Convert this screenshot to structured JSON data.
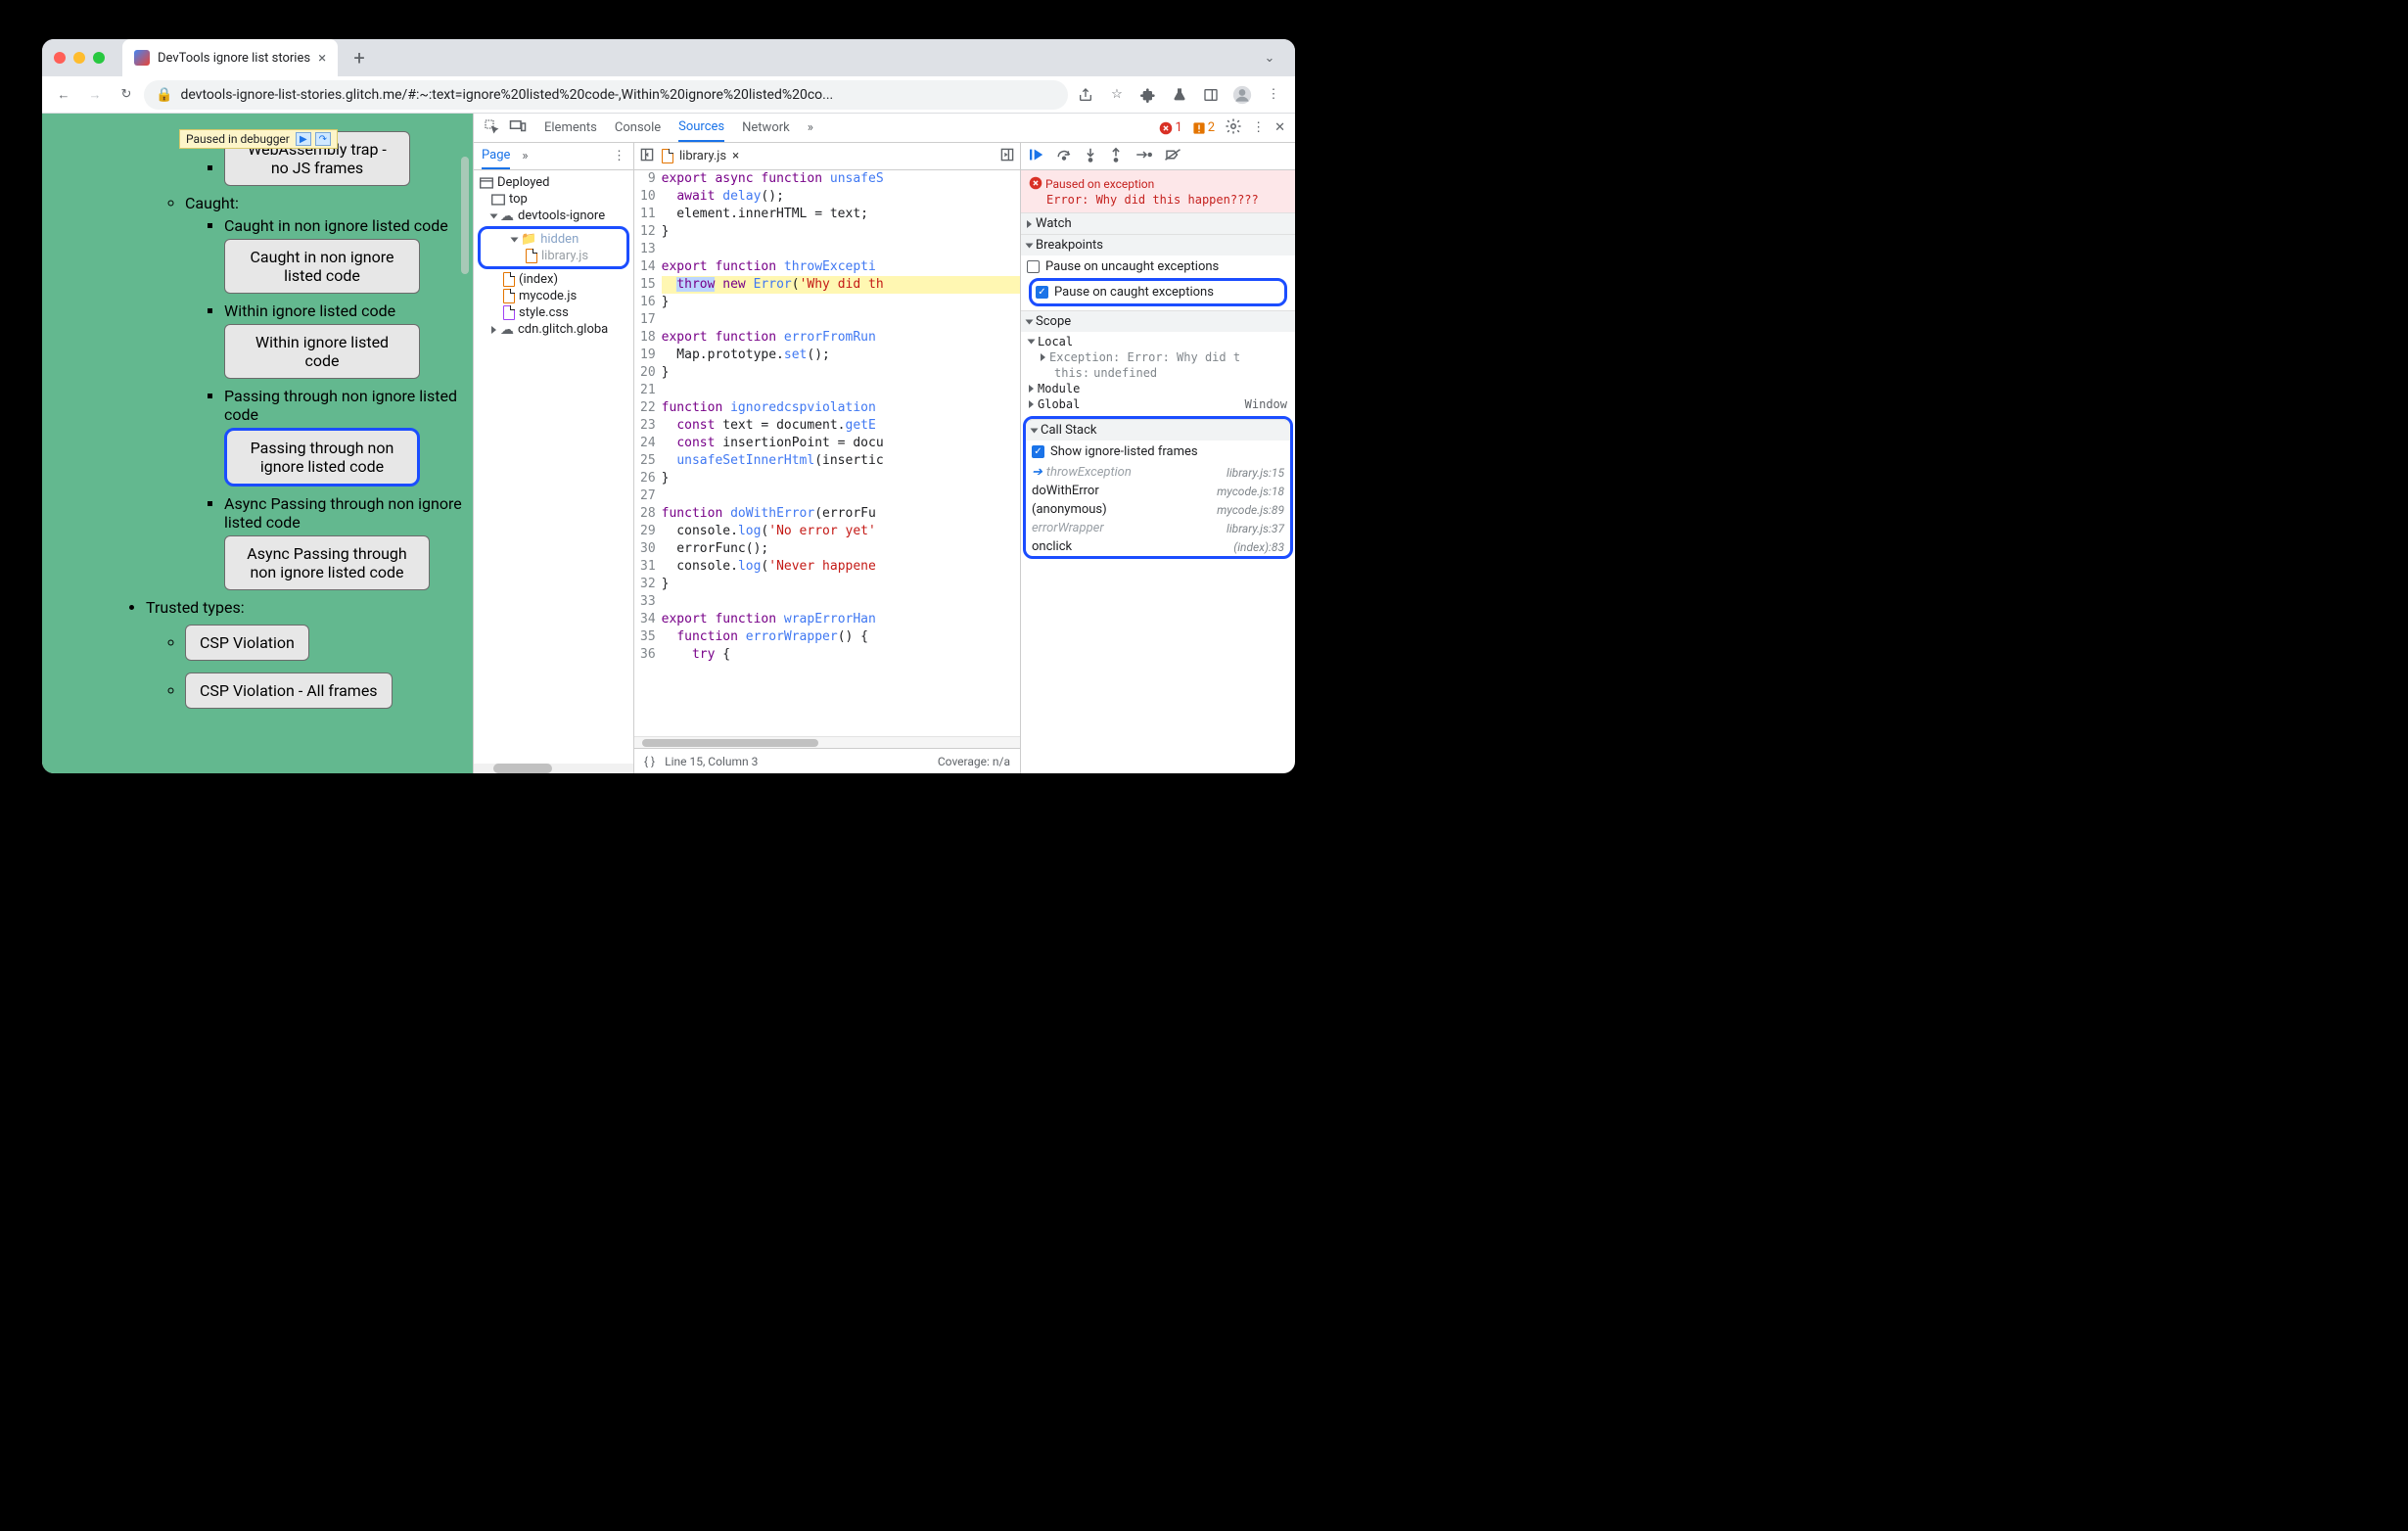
{
  "window": {
    "tab_title": "DevTools ignore list stories",
    "url": "devtools-ignore-list-stories.glitch.me/#:~:text=ignore%20listed%20code-,Within%20ignore%20listed%20co..."
  },
  "paused_pill": "Paused in debugger",
  "page_content": {
    "top_button": "WebAssembly trap - no JS frames",
    "caught_label": "Caught:",
    "item1_label": "Caught in non ignore listed code",
    "item1_btn": "Caught in non ignore listed code",
    "item2_label": "Within ignore listed code",
    "item2_btn": "Within ignore listed code",
    "item3_label": "Passing through non ignore listed code",
    "item3_btn": "Passing through non ignore listed code",
    "item4_label": "Async Passing through non ignore listed code",
    "item4_btn": "Async Passing through non ignore listed code",
    "trusted_label": "Trusted types:",
    "tt1_btn": "CSP Violation",
    "tt2_btn": "CSP Violation - All frames"
  },
  "devtools": {
    "tabs": [
      "Elements",
      "Console",
      "Sources",
      "Network"
    ],
    "active_tab": "Sources",
    "error_count": "1",
    "warn_count": "2"
  },
  "navigator": {
    "page_tab": "Page",
    "deployed": "Deployed",
    "top": "top",
    "domain": "devtools-ignore",
    "hidden_folder": "hidden",
    "hidden_file": "library.js",
    "index": "(index)",
    "mycode": "mycode.js",
    "style": "style.css",
    "cdn": "cdn.glitch.globa"
  },
  "editor": {
    "tab": "library.js",
    "gutter_start": 9,
    "gutter_end": 36,
    "lines": {
      "l9": "export async function unsafeS",
      "l10": "  await delay();",
      "l11": "  element.innerHTML = text;",
      "l12": "}",
      "l13": "",
      "l14": "export function throwExcepti",
      "l15_sel": "throw",
      "l15_rest": " new Error('Why did th",
      "l16": "}",
      "l17": "",
      "l18": "export function errorFromRun",
      "l19": "  Map.prototype.set();",
      "l20": "}",
      "l21": "",
      "l22": "function ignoredcspviolation",
      "l23": "  const text = document.getE",
      "l24": "  const insertionPoint = docu",
      "l25": "  unsafeSetInnerHtml(insertic",
      "l26": "}",
      "l27": "",
      "l28": "function doWithError(errorFu",
      "l29": "  console.log('No error yet'",
      "l30": "  errorFunc();",
      "l31": "  console.log('Never happene",
      "l32": "}",
      "l33": "",
      "l34": "export function wrapErrorHan",
      "l35": "  function errorWrapper() {",
      "l36": "    try {"
    },
    "status": "Line 15, Column 3",
    "coverage": "Coverage: n/a"
  },
  "debugger": {
    "paused_title": "Paused on exception",
    "paused_msg": "Error: Why did this happen????",
    "watch": "Watch",
    "breakpoints": "Breakpoints",
    "bp_uncaught": "Pause on uncaught exceptions",
    "bp_caught": "Pause on caught exceptions",
    "scope": "Scope",
    "scope_local": "Local",
    "scope_exception": "Exception: Error: Why did t",
    "scope_this": "this: ",
    "scope_this_val": "undefined",
    "scope_module": "Module",
    "scope_global": "Global",
    "scope_global_val": "Window",
    "callstack": "Call Stack",
    "cs_show": "Show ignore-listed frames",
    "frames": [
      {
        "name": "throwException",
        "loc": "library.js:15",
        "ignored": true,
        "current": true
      },
      {
        "name": "doWithError",
        "loc": "mycode.js:18",
        "ignored": false
      },
      {
        "name": "(anonymous)",
        "loc": "mycode.js:89",
        "ignored": false
      },
      {
        "name": "errorWrapper",
        "loc": "library.js:37",
        "ignored": true
      },
      {
        "name": "onclick",
        "loc": "(index):83",
        "ignored": false
      }
    ]
  }
}
